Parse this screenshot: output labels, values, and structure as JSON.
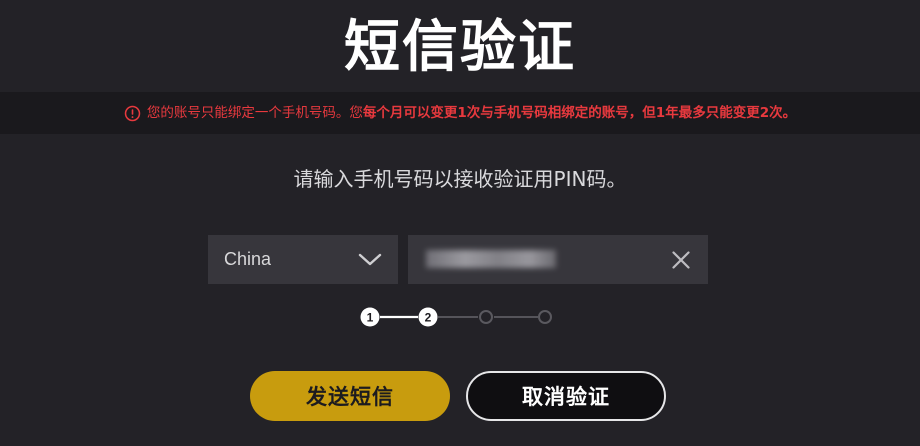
{
  "page": {
    "title": "短信验证"
  },
  "notice": {
    "icon": "alert-circle-icon",
    "text_normal": "您的账号只能绑定一个手机号码。您",
    "text_bold": "每个月可以变更1次与手机号码相绑定的账号，但1年最多只能变更2次。",
    "color": "#e8393e"
  },
  "instruction": "请输入手机号码以接收验证用PIN码。",
  "form": {
    "country": {
      "selected": "China",
      "icon": "chevron-down-icon"
    },
    "phone": {
      "value": "",
      "clear_icon": "close-icon"
    }
  },
  "stepper": {
    "current_step": 2,
    "total_steps": 4,
    "steps": [
      {
        "label": "1"
      },
      {
        "label": "2"
      },
      {
        "label": ""
      },
      {
        "label": ""
      }
    ]
  },
  "actions": {
    "send_label": "发送短信",
    "cancel_label": "取消验证"
  },
  "colors": {
    "background": "#232227",
    "accent": "#c89c0e",
    "field": "#37363c"
  }
}
